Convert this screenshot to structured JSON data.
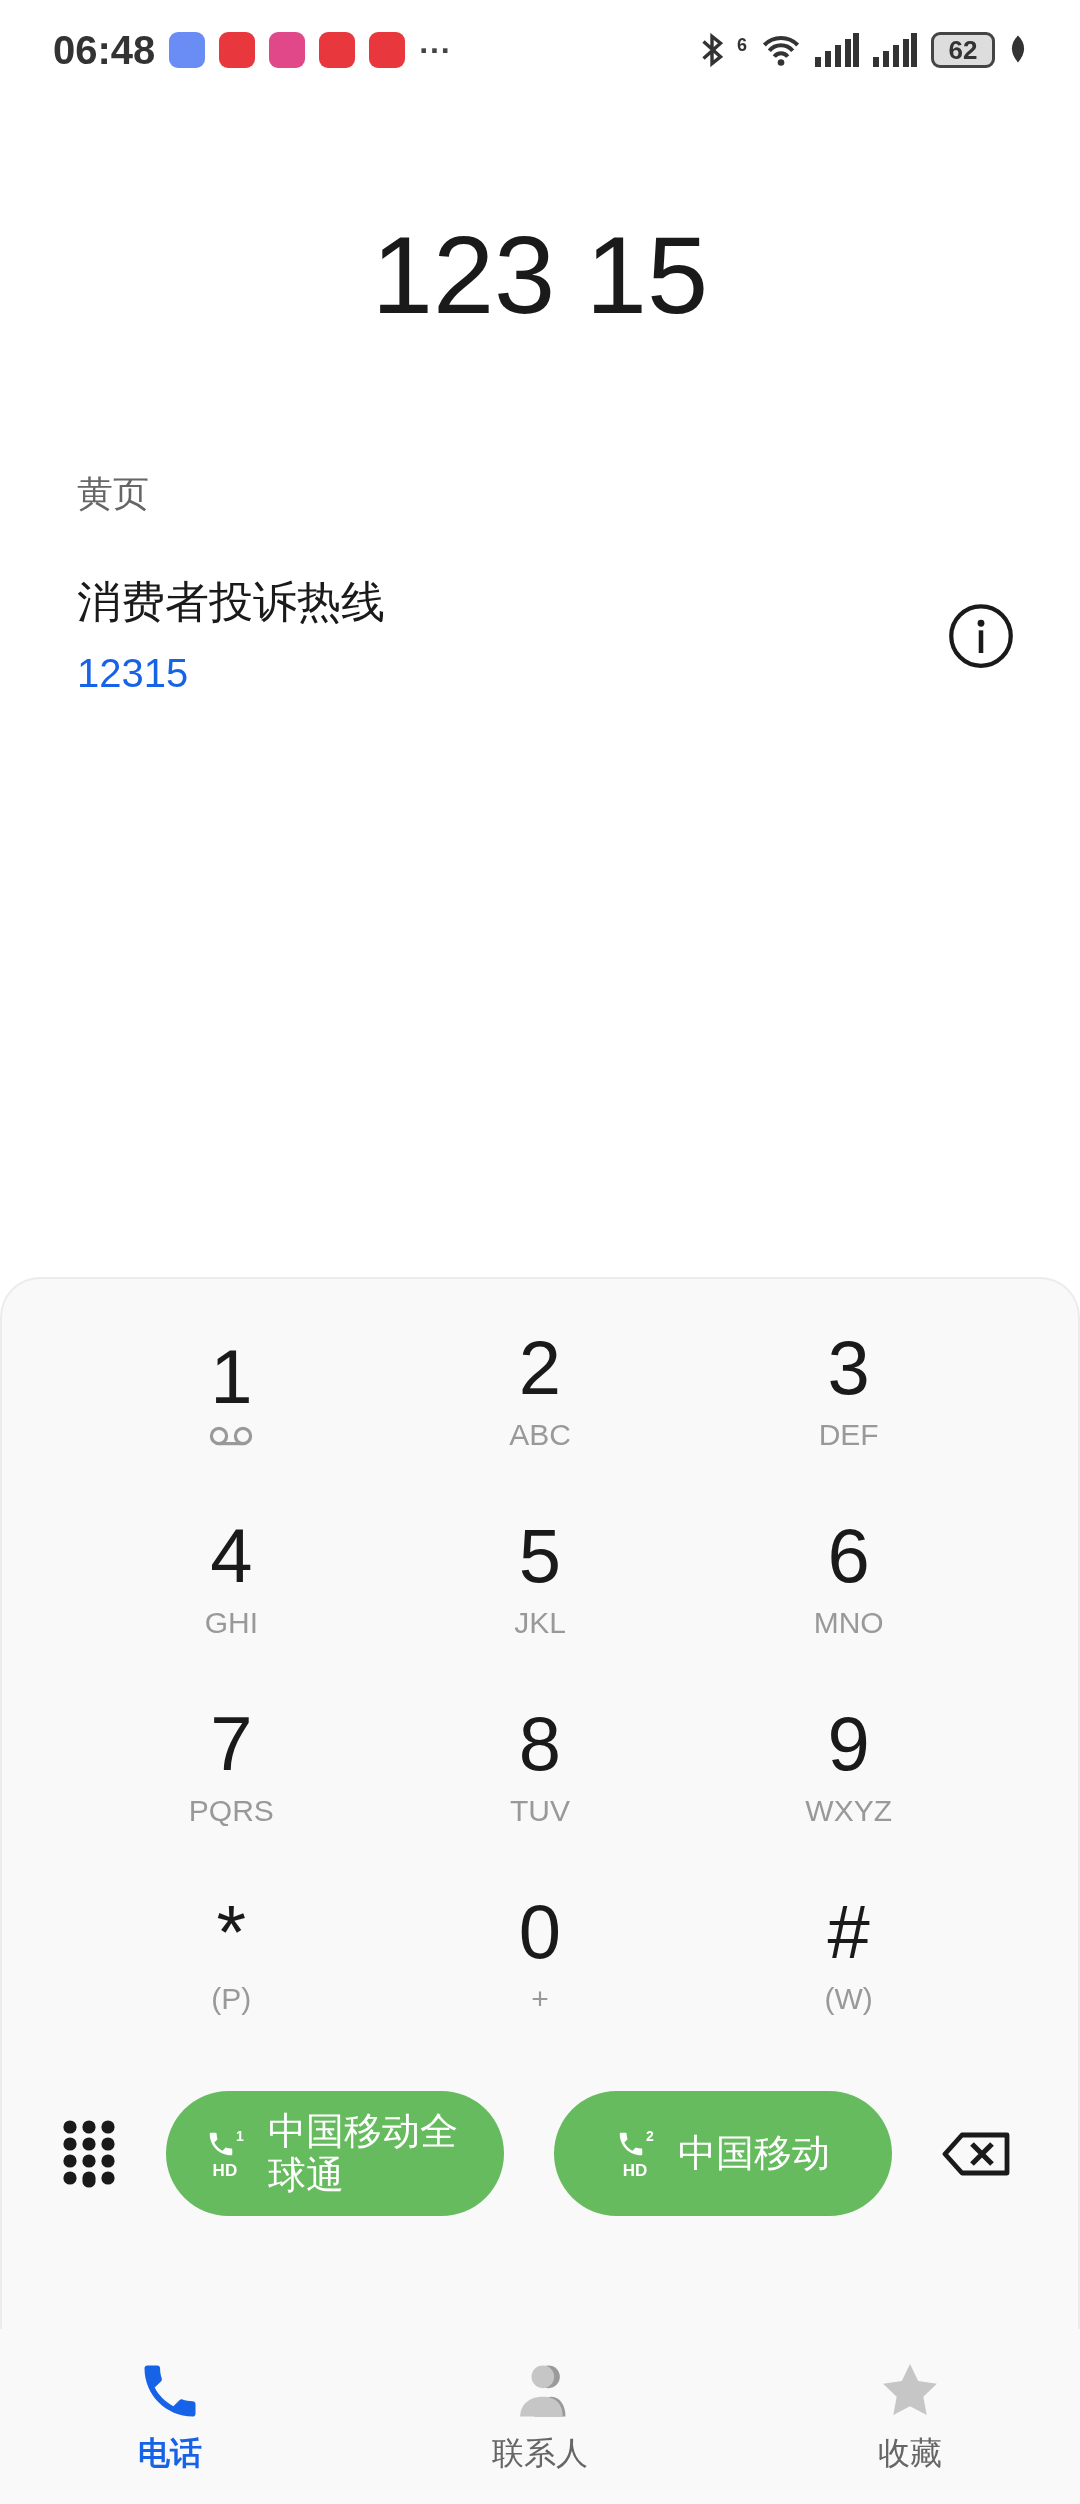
{
  "status_bar": {
    "time": "06:48",
    "notifications": [
      {
        "color": "#6a8cf5"
      },
      {
        "color": "#e8383d"
      },
      {
        "color": "#e0488a"
      },
      {
        "color": "#e8383d"
      },
      {
        "color": "#e8383d"
      }
    ],
    "more": "···",
    "wifi_label": "6",
    "battery": "62"
  },
  "dialed_number": "123 15",
  "yellow_pages": {
    "heading": "黄页",
    "entry": {
      "name": "消费者投诉热线",
      "number": "12315"
    }
  },
  "keypad": [
    {
      "digit": "1",
      "kind": "voicemail"
    },
    {
      "digit": "2",
      "kind": "letters",
      "sub": "ABC"
    },
    {
      "digit": "3",
      "kind": "letters",
      "sub": "DEF"
    },
    {
      "digit": "4",
      "kind": "letters",
      "sub": "GHI"
    },
    {
      "digit": "5",
      "kind": "letters",
      "sub": "JKL"
    },
    {
      "digit": "6",
      "kind": "letters",
      "sub": "MNO"
    },
    {
      "digit": "7",
      "kind": "letters",
      "sub": "PQRS"
    },
    {
      "digit": "8",
      "kind": "letters",
      "sub": "TUV"
    },
    {
      "digit": "9",
      "kind": "letters",
      "sub": "WXYZ"
    },
    {
      "digit": "*",
      "kind": "letters",
      "sub": "(P)"
    },
    {
      "digit": "0",
      "kind": "letters",
      "sub": "+"
    },
    {
      "digit": "#",
      "kind": "letters",
      "sub": "(W)"
    }
  ],
  "call_buttons": [
    {
      "sim": "1",
      "hd": "HD",
      "label": "中国移动全球通"
    },
    {
      "sim": "2",
      "hd": "HD",
      "label": "中国移动"
    }
  ],
  "bottom_nav": [
    {
      "kind": "phone",
      "label": "电话",
      "selected": true
    },
    {
      "kind": "contacts",
      "label": "联系人",
      "selected": false
    },
    {
      "kind": "favorites",
      "label": "收藏",
      "selected": false
    }
  ]
}
